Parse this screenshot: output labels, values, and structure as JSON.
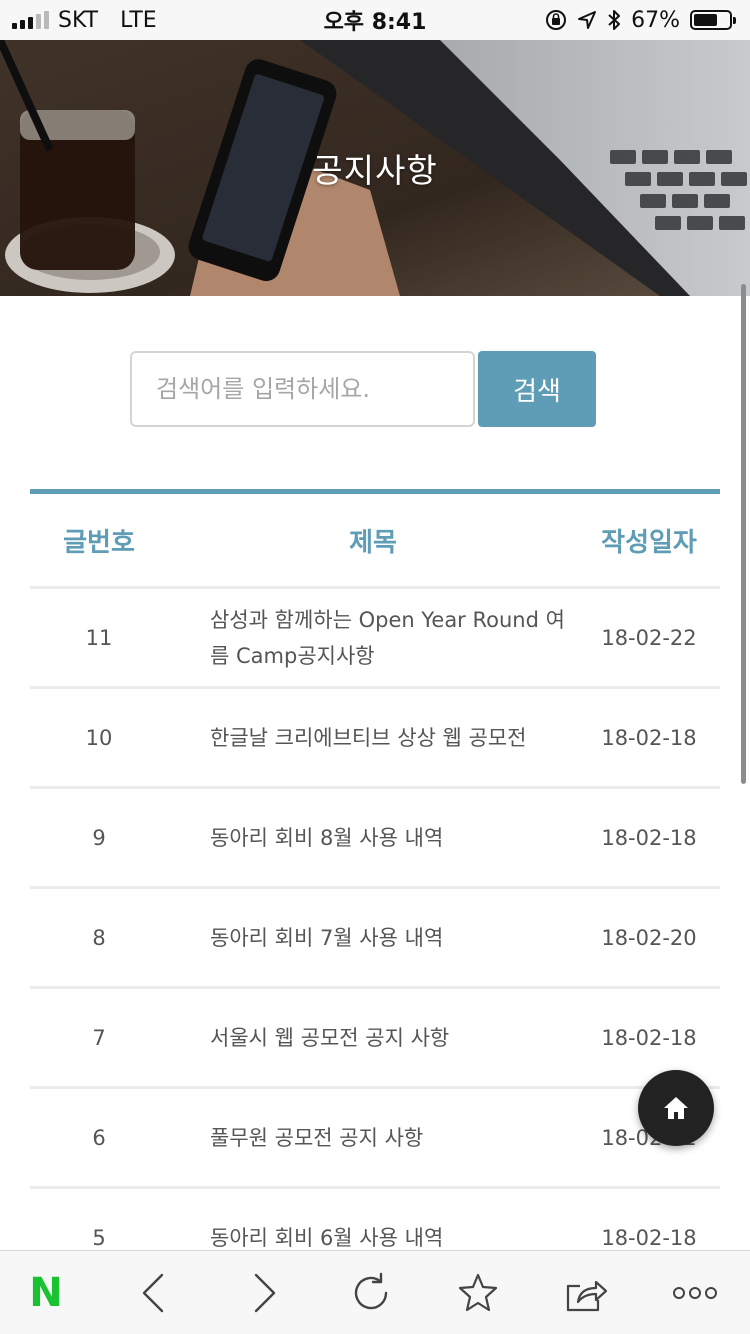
{
  "status_bar": {
    "carrier": "SKT",
    "network": "LTE",
    "time": "오후 8:41",
    "battery_percent": "67%",
    "battery_level": 0.67,
    "icons": [
      "orientation-lock-icon",
      "location-arrow-icon",
      "bluetooth-icon",
      "battery-icon"
    ]
  },
  "hero": {
    "title": "공지사항"
  },
  "search": {
    "placeholder": "검색어를 입력하세요.",
    "button_label": "검색"
  },
  "table": {
    "headers": {
      "no": "글번호",
      "title": "제목",
      "date": "작성일자"
    },
    "rows": [
      {
        "no": "11",
        "title": "삼성과 함께하는 Open Year Round 여름 Camp공지사항",
        "date": "18-02-22"
      },
      {
        "no": "10",
        "title": "한글날 크리에브티브 상상 웹 공모전",
        "date": "18-02-18"
      },
      {
        "no": "9",
        "title": "동아리 회비 8월 사용 내역",
        "date": "18-02-18"
      },
      {
        "no": "8",
        "title": "동아리 회비 7월 사용 내역",
        "date": "18-02-20"
      },
      {
        "no": "7",
        "title": "서울시 웹 공모전 공지 사항",
        "date": "18-02-18"
      },
      {
        "no": "6",
        "title": "풀무원 공모전 공지 사항",
        "date": "18-02-22"
      },
      {
        "no": "5",
        "title": "동아리 회비 6월 사용 내역",
        "date": "18-02-18"
      }
    ]
  },
  "fab": {
    "icon": "home-icon"
  },
  "bottom_bar": {
    "logo": "N",
    "icons": [
      "back-icon",
      "forward-icon",
      "reload-icon",
      "bookmark-star-icon",
      "share-icon",
      "more-icon"
    ]
  },
  "colors": {
    "accent": "#5e9db5",
    "naver_green": "#19c22f"
  }
}
